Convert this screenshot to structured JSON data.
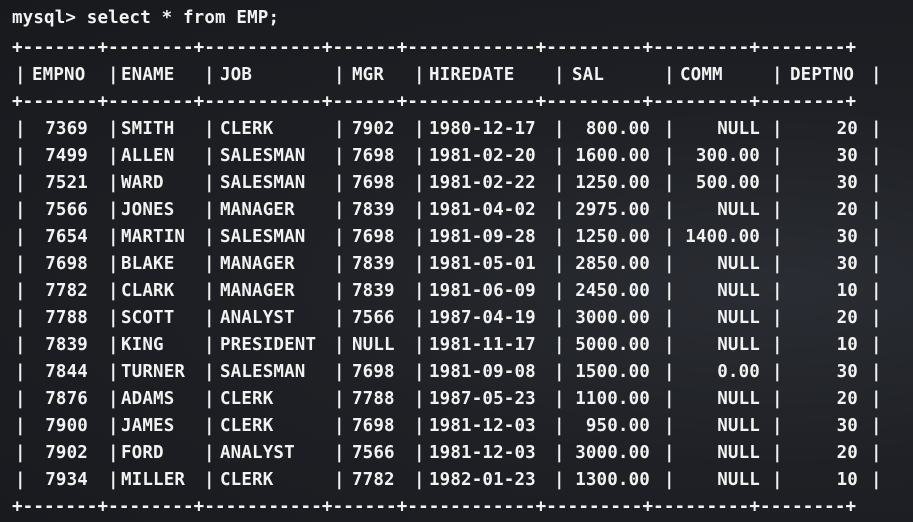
{
  "terminal": {
    "prompt": "mysql> select * from EMP;",
    "border": "+-------+--------+-----------+------+------------+---------+---------+--------+"
  },
  "table": {
    "columns": [
      "EMPNO",
      "ENAME",
      "JOB",
      "MGR",
      "HIREDATE",
      "SAL",
      "COMM",
      "DEPTNO"
    ],
    "rows": [
      [
        "7369",
        "SMITH",
        "CLERK",
        "7902",
        "1980-12-17",
        "800.00",
        "NULL",
        "20"
      ],
      [
        "7499",
        "ALLEN",
        "SALESMAN",
        "7698",
        "1981-02-20",
        "1600.00",
        "300.00",
        "30"
      ],
      [
        "7521",
        "WARD",
        "SALESMAN",
        "7698",
        "1981-02-22",
        "1250.00",
        "500.00",
        "30"
      ],
      [
        "7566",
        "JONES",
        "MANAGER",
        "7839",
        "1981-04-02",
        "2975.00",
        "NULL",
        "20"
      ],
      [
        "7654",
        "MARTIN",
        "SALESMAN",
        "7698",
        "1981-09-28",
        "1250.00",
        "1400.00",
        "30"
      ],
      [
        "7698",
        "BLAKE",
        "MANAGER",
        "7839",
        "1981-05-01",
        "2850.00",
        "NULL",
        "30"
      ],
      [
        "7782",
        "CLARK",
        "MANAGER",
        "7839",
        "1981-06-09",
        "2450.00",
        "NULL",
        "10"
      ],
      [
        "7788",
        "SCOTT",
        "ANALYST",
        "7566",
        "1987-04-19",
        "3000.00",
        "NULL",
        "20"
      ],
      [
        "7839",
        "KING",
        "PRESIDENT",
        "NULL",
        "1981-11-17",
        "5000.00",
        "NULL",
        "10"
      ],
      [
        "7844",
        "TURNER",
        "SALESMAN",
        "7698",
        "1981-09-08",
        "1500.00",
        "0.00",
        "30"
      ],
      [
        "7876",
        "ADAMS",
        "CLERK",
        "7788",
        "1987-05-23",
        "1100.00",
        "NULL",
        "20"
      ],
      [
        "7900",
        "JAMES",
        "CLERK",
        "7698",
        "1981-12-03",
        "950.00",
        "NULL",
        "30"
      ],
      [
        "7902",
        "FORD",
        "ANALYST",
        "7566",
        "1981-12-03",
        "3000.00",
        "NULL",
        "20"
      ],
      [
        "7934",
        "MILLER",
        "CLERK",
        "7782",
        "1982-01-23",
        "1300.00",
        "NULL",
        "10"
      ]
    ]
  },
  "colors": {
    "background": "#1b1d22",
    "text": "#f2f2f2"
  }
}
